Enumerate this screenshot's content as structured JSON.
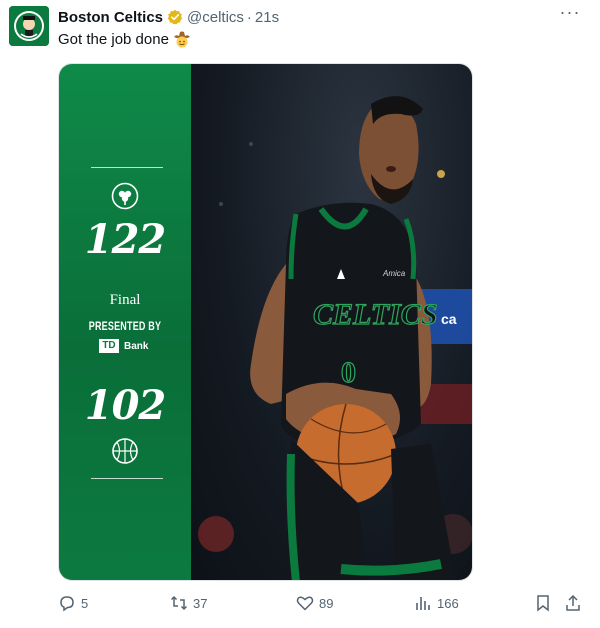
{
  "tweet": {
    "author_name": "Boston Celtics",
    "handle": "@celtics",
    "separator": "·",
    "time": "21s",
    "text": "Got the job done",
    "more_label": "···",
    "emoji": "face-with-cowboy-hat"
  },
  "scorecard": {
    "home_score": "122",
    "status": "Final",
    "presented_by": "PRESENTED BY",
    "sponsor_logo": "TD",
    "sponsor_name": "Bank",
    "away_score": "102",
    "home_team_logo": "celtics-logo",
    "away_team_logo": "wizards-logo"
  },
  "photo": {
    "jersey_text": "CELTICS",
    "number": "0",
    "sponsor_patch": "Amica"
  },
  "actions": {
    "replies": "5",
    "retweets": "37",
    "likes": "89",
    "views": "166"
  },
  "colors": {
    "celtics_green": "#0b7a3f",
    "text_primary": "#0f1419",
    "text_secondary": "#536471",
    "verified_gold": "#e2b719"
  }
}
